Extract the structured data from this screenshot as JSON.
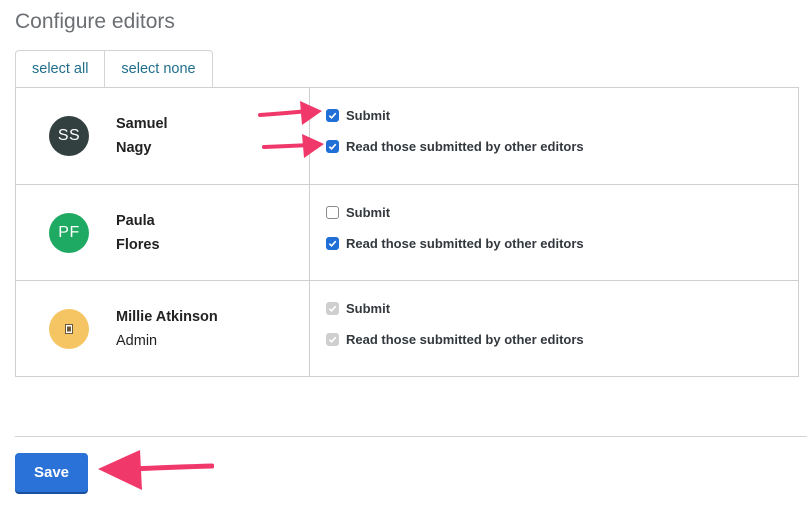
{
  "page": {
    "title": "Configure editors"
  },
  "tabs": [
    {
      "label": "select all"
    },
    {
      "label": "select none"
    }
  ],
  "editors": [
    {
      "initials": "SS",
      "avatar_color": "#32403f",
      "name_line1": "Samuel",
      "name_line2": "Nagy",
      "permissions": [
        {
          "label": "Submit",
          "checked": true,
          "disabled": false
        },
        {
          "label": "Read those submitted by other editors",
          "checked": true,
          "disabled": false
        }
      ]
    },
    {
      "initials": "PF",
      "avatar_color": "#1faa63",
      "name_line1": "Paula",
      "name_line2": "Flores",
      "permissions": [
        {
          "label": "Submit",
          "checked": false,
          "disabled": false
        },
        {
          "label": "Read those submitted by other editors",
          "checked": true,
          "disabled": false
        }
      ]
    },
    {
      "initials": "",
      "avatar_color": "#f5c563",
      "name_line1": "Millie Atkinson",
      "name_line2": "Admin",
      "permissions": [
        {
          "label": "Submit",
          "checked": true,
          "disabled": true
        },
        {
          "label": "Read those submitted by other editors",
          "checked": true,
          "disabled": true
        }
      ]
    }
  ],
  "footer": {
    "save_label": "Save"
  },
  "colors": {
    "accent": "#2a72d8",
    "annotation_arrow": "#f0396a"
  }
}
